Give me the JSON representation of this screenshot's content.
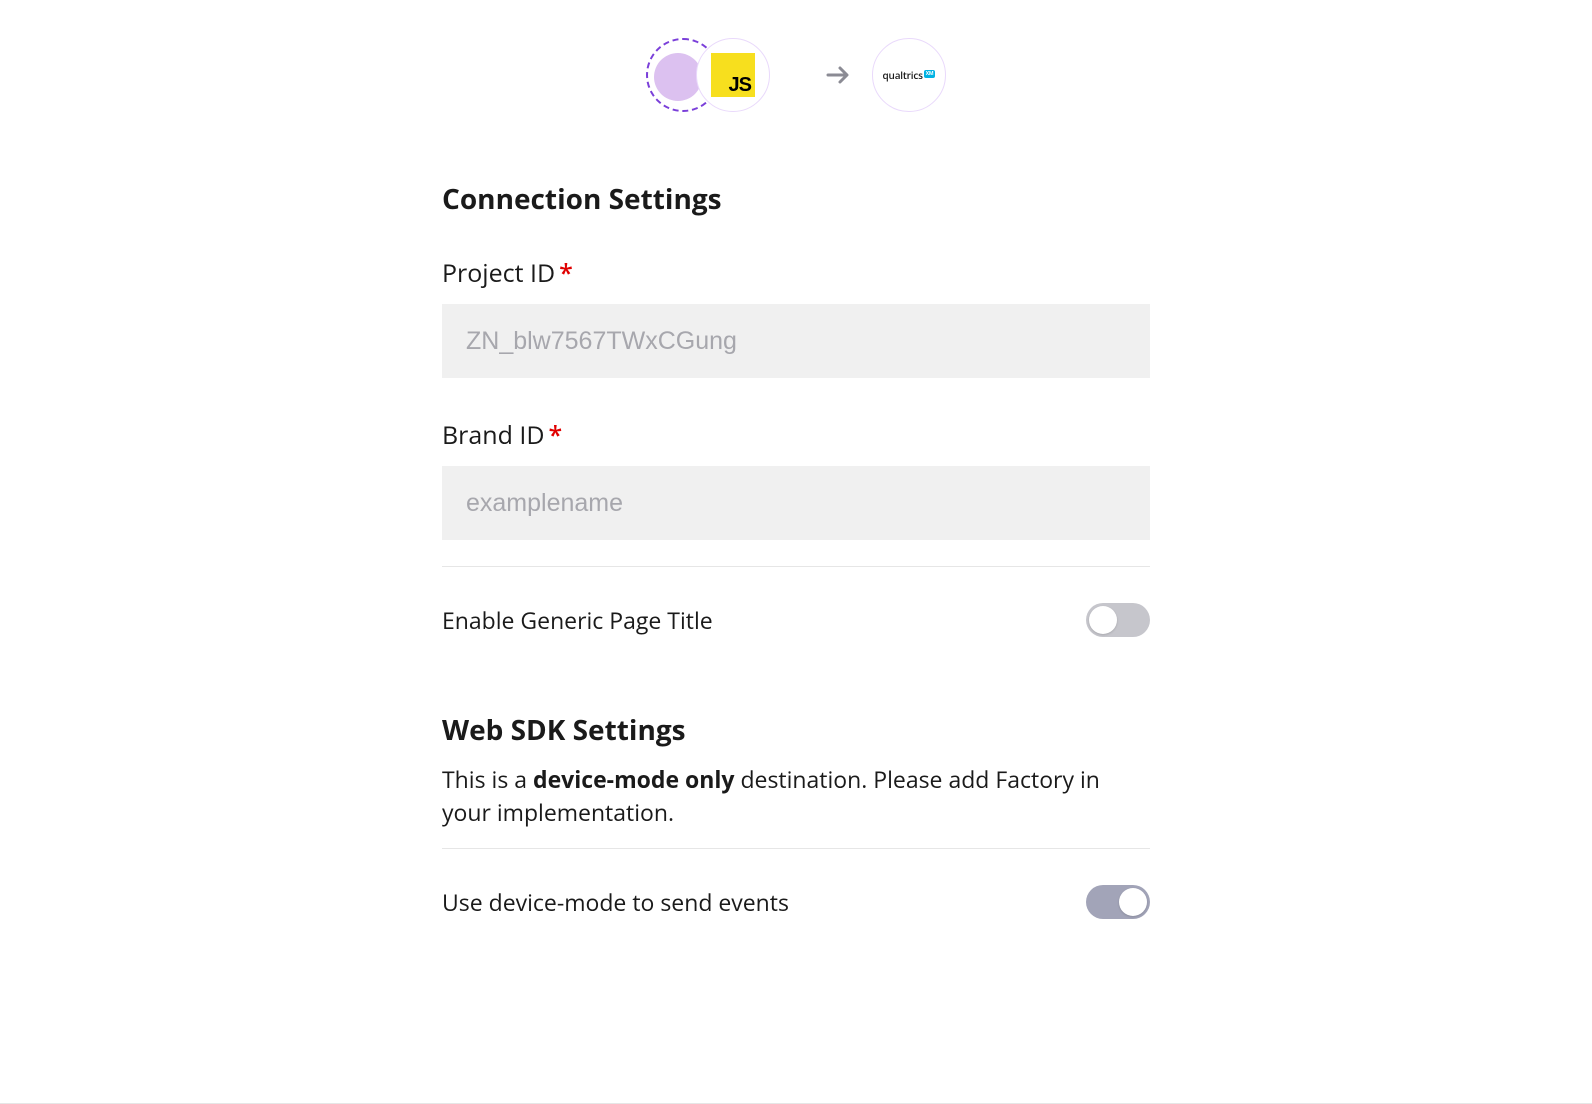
{
  "header": {
    "source_badge": "JS",
    "destination_logo_text": "qualtrics",
    "destination_logo_badge": "XM"
  },
  "sections": {
    "connection": {
      "title": "Connection Settings",
      "fields": {
        "project_id": {
          "label": "Project ID",
          "required_mark": "*",
          "placeholder": "ZN_blw7567TWxCGung",
          "value": ""
        },
        "brand_id": {
          "label": "Brand ID",
          "required_mark": "*",
          "placeholder": "examplename",
          "value": ""
        }
      },
      "toggles": {
        "generic_page_title": {
          "label": "Enable Generic Page Title",
          "on": false
        }
      }
    },
    "web_sdk": {
      "title": "Web SDK Settings",
      "description_pre": "This is a ",
      "description_bold": "device-mode only",
      "description_post": " destination. Please add Factory in your implementation.",
      "toggles": {
        "device_mode": {
          "label": "Use device-mode to send events",
          "on": true
        }
      }
    }
  }
}
